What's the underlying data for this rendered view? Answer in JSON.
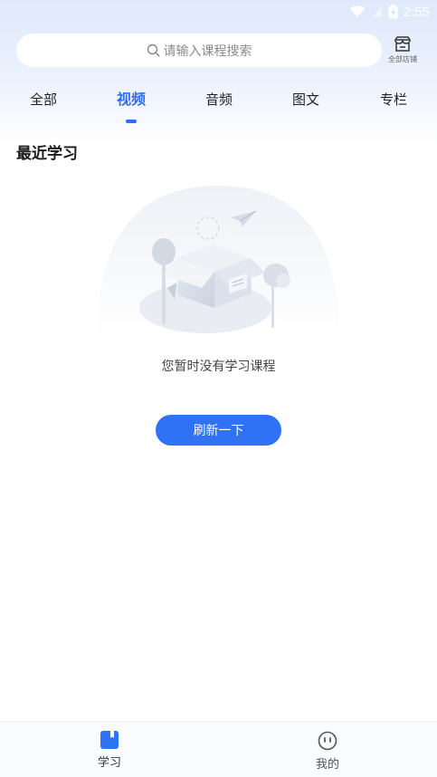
{
  "status_bar": {
    "time": "2:55"
  },
  "search": {
    "placeholder": "请输入课程搜索"
  },
  "store": {
    "label": "全部店铺"
  },
  "tabs": [
    {
      "label": "全部"
    },
    {
      "label": "视频"
    },
    {
      "label": "音频"
    },
    {
      "label": "图文"
    },
    {
      "label": "专栏"
    }
  ],
  "active_tab": "视频",
  "section": {
    "title": "最近学习"
  },
  "empty_state": {
    "message": "您暂时没有学习课程",
    "button_label": "刷新一下"
  },
  "bottom_nav": [
    {
      "label": "学习",
      "active": true
    },
    {
      "label": "我的",
      "active": false
    }
  ],
  "colors": {
    "accent": "#2f72f5",
    "active_tab": "#2f6ff0"
  },
  "icons": [
    "wifi-icon",
    "signal-icon",
    "battery-icon",
    "search-icon",
    "store-icon",
    "book-icon",
    "profile-icon"
  ]
}
